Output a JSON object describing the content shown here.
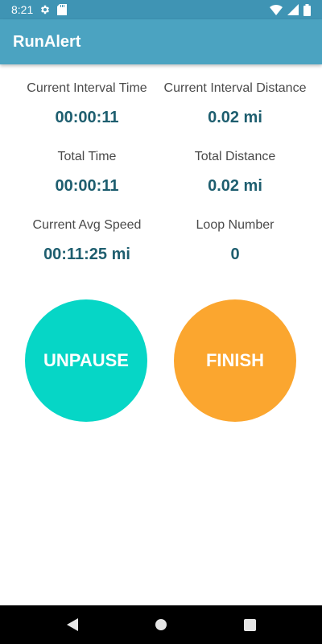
{
  "status_bar": {
    "time": "8:21",
    "icons": [
      "gear-icon",
      "sd-card-icon",
      "wifi-icon",
      "signal-icon",
      "battery-icon"
    ]
  },
  "app": {
    "title": "RunAlert"
  },
  "stats": {
    "current_interval_time": {
      "label": "Current Interval Time",
      "value": "00:00:11"
    },
    "current_interval_distance": {
      "label": "Current Interval Distance",
      "value": "0.02 mi"
    },
    "total_time": {
      "label": "Total Time",
      "value": "00:00:11"
    },
    "total_distance": {
      "label": "Total Distance",
      "value": "0.02 mi"
    },
    "current_avg_speed": {
      "label": "Current Avg Speed",
      "value": "00:11:25 mi"
    },
    "loop_number": {
      "label": "Loop Number",
      "value": "0"
    }
  },
  "buttons": {
    "unpause": "UNPAUSE",
    "finish": "FINISH"
  },
  "colors": {
    "status_bar": "#3f94b4",
    "app_bar": "#4ba3c1",
    "value_text": "#1e5e6f",
    "unpause": "#06d6c6",
    "finish": "#fba62f"
  },
  "nav_bar": {
    "icons": [
      "back-icon",
      "home-icon",
      "recents-icon"
    ]
  }
}
